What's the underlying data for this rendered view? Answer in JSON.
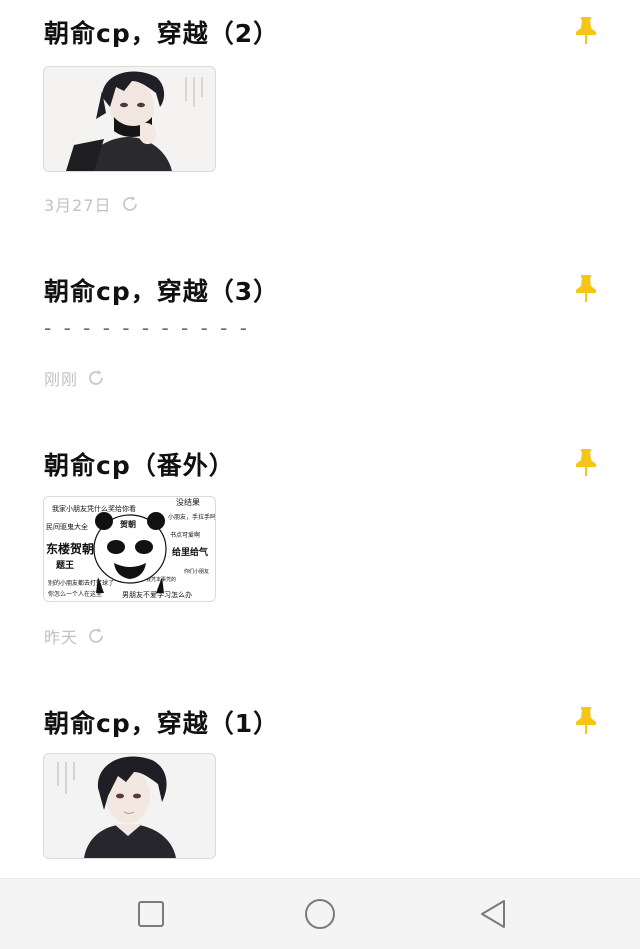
{
  "notes": [
    {
      "title": "朝俞cp，穿越（2）",
      "date": "3月27日",
      "thumbnail": "anime-boy-mask"
    },
    {
      "title": "朝俞cp，穿越（3）",
      "preview": "- - - - - - - - - - -",
      "date": "刚刚"
    },
    {
      "title": "朝俞cp（番外）",
      "date": "昨天",
      "thumbnail": "panda-meme",
      "meme_text": {
        "lines": [
          "我家小朋友凭什么奖给你看",
          "民间驱鬼大全",
          "东楼贺朝",
          "题王",
          "别的小朋友都去打篮球了",
          "你怎么一个人在这里",
          "男朋友不爱学习怎么办",
          "给里给气",
          "小朋友，手拉手吗",
          "我凭本事凭的",
          "你们小朋友",
          "没结果",
          "书点可爱啊"
        ],
        "center_label": "贺朝"
      }
    },
    {
      "title": "朝俞cp，穿越（1）",
      "thumbnail": "anime-boy-portrait"
    }
  ],
  "icons": {
    "pin": "pin-icon",
    "sync": "sync-icon"
  },
  "colors": {
    "pin": "#f5c518",
    "date": "#c2c2c2",
    "navbar": "#f4f4f4",
    "nav_icon": "#7a7a7a"
  },
  "navbar": {
    "buttons": [
      "recent-apps",
      "home",
      "back"
    ]
  }
}
